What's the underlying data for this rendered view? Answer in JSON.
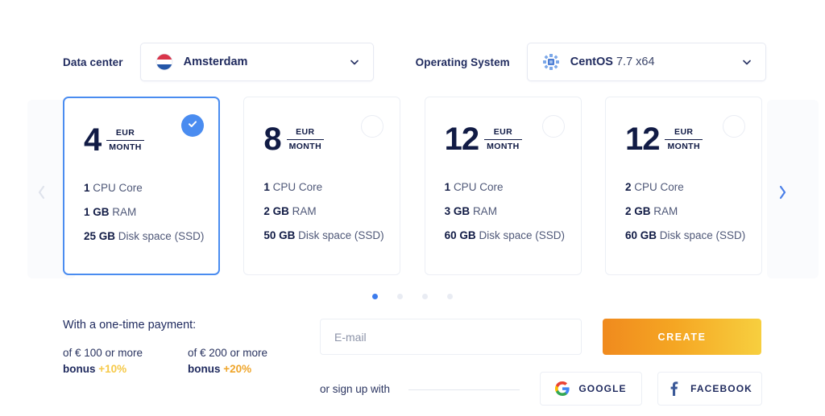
{
  "selectors": {
    "datacenter": {
      "label": "Data center",
      "value": "Amsterdam",
      "icon": "netherlands-flag-icon",
      "chevron": "chevron-down-icon"
    },
    "os": {
      "label": "Operating System",
      "name": "CentOS",
      "version": "7.7 x64",
      "icon": "centos-logo-icon",
      "chevron": "chevron-down-icon"
    }
  },
  "carousel": {
    "prev_arrow": "chevron-left-icon",
    "next_arrow": "chevron-right-icon",
    "prev_enabled": false,
    "next_enabled": true,
    "dots": [
      {
        "active": true
      },
      {
        "active": false
      },
      {
        "active": false
      },
      {
        "active": false
      }
    ],
    "currency": "EUR",
    "period": "MONTH",
    "check_icon": "check-icon",
    "plans": [
      {
        "price": "4",
        "currency": "EUR",
        "period": "MONTH",
        "selected": true,
        "cpu_value": "1",
        "cpu_label": "CPU Core",
        "ram_value": "1 GB",
        "ram_label": "RAM",
        "disk_value": "25 GB",
        "disk_label": "Disk space (SSD)"
      },
      {
        "price": "8",
        "currency": "EUR",
        "period": "MONTH",
        "selected": false,
        "cpu_value": "1",
        "cpu_label": "CPU Core",
        "ram_value": "2 GB",
        "ram_label": "RAM",
        "disk_value": "50 GB",
        "disk_label": "Disk space (SSD)"
      },
      {
        "price": "12",
        "currency": "EUR",
        "period": "MONTH",
        "selected": false,
        "cpu_value": "1",
        "cpu_label": "CPU Core",
        "ram_value": "3 GB",
        "ram_label": "RAM",
        "disk_value": "60 GB",
        "disk_label": "Disk space (SSD)"
      },
      {
        "price": "12",
        "currency": "EUR",
        "period": "MONTH",
        "selected": false,
        "cpu_value": "2",
        "cpu_label": "CPU Core",
        "ram_value": "2 GB",
        "ram_label": "RAM",
        "disk_value": "60 GB",
        "disk_label": "Disk space (SSD)"
      }
    ]
  },
  "payment": {
    "title": "With a one-time payment:",
    "tiers": [
      {
        "threshold": "of € 100 or more",
        "bonus_label": "bonus",
        "bonus_value": "+10%",
        "color": "#f6c948"
      },
      {
        "threshold": "of € 200 or more",
        "bonus_label": "bonus",
        "bonus_value": "+20%",
        "color": "#efa52a"
      }
    ]
  },
  "signup": {
    "email_placeholder": "E-mail",
    "email_value": "",
    "create_label": "CREATE",
    "create_gradient_from": "#f08a1e",
    "create_gradient_to": "#f7cf3f",
    "or_text": "or sign up with",
    "google_label": "GOOGLE",
    "google_icon": "google-g-icon",
    "facebook_label": "FACEBOOK",
    "facebook_icon": "facebook-f-icon"
  }
}
